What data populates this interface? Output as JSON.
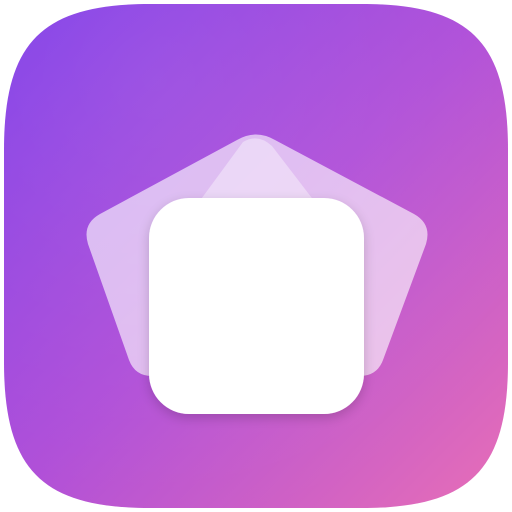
{
  "app_icon": {
    "icon_name": "stacked-shapes-app-icon",
    "colors": {
      "gradient_start": "#7f3ce8",
      "gradient_mid": "#b04fd8",
      "gradient_end": "#e86fb6",
      "foreground": "#ffffff"
    }
  }
}
